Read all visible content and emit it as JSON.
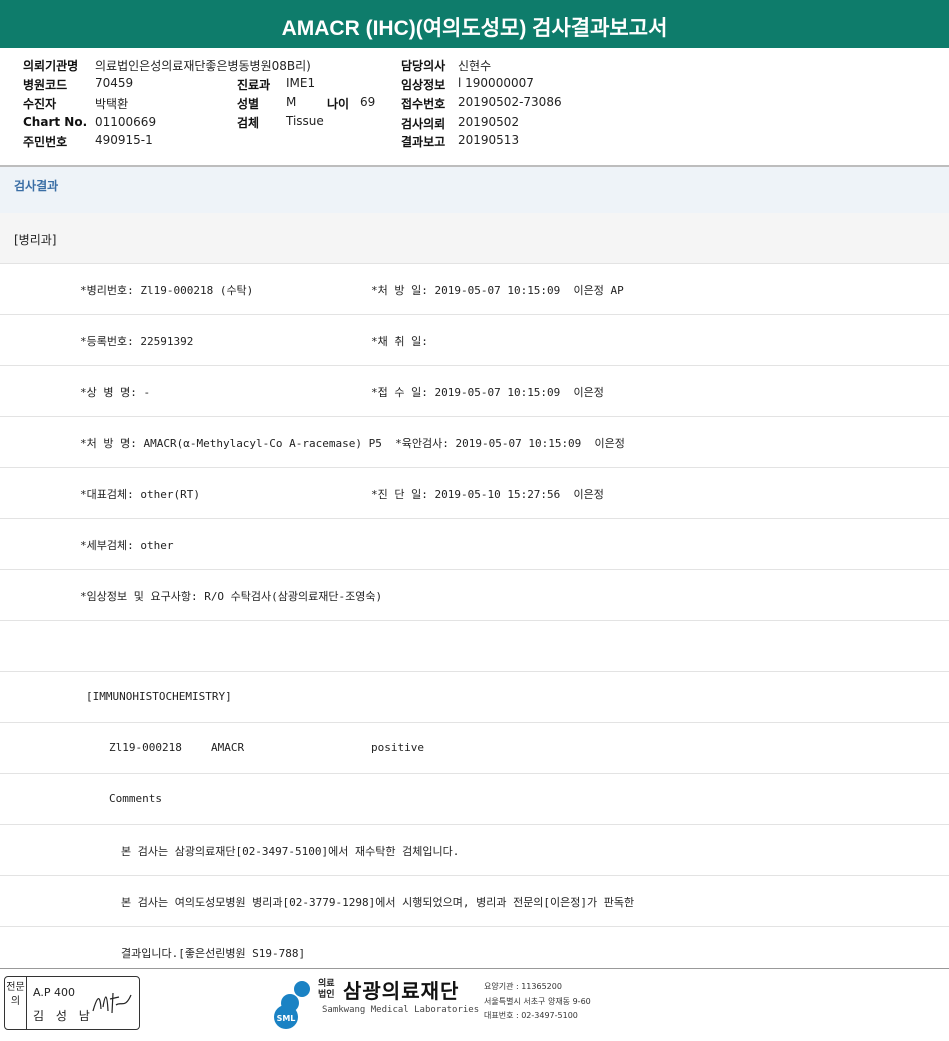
{
  "title": "AMACR (IHC)(여의도성모) 검사결과보고서",
  "header": {
    "rows": [
      {
        "label": "의뢰기관명",
        "value": "의료법인은성의료재단좋은병동병원08B리)"
      },
      {
        "label": "병원코드",
        "value": "70459"
      },
      {
        "label": "수진자",
        "value": "박택환"
      },
      {
        "label": "Chart No.",
        "value": "01100669"
      },
      {
        "label": "주민번호",
        "value": "490915-1"
      },
      {
        "label": "진료과",
        "value": "IME1"
      },
      {
        "label": "성별",
        "value": "M"
      },
      {
        "label": "나이",
        "value": "69"
      },
      {
        "label": "검체",
        "value": "Tissue"
      },
      {
        "label": "담당의사",
        "value": "신현수"
      },
      {
        "label": "임상정보",
        "value": "l 190000007"
      },
      {
        "label": "접수번호",
        "value": "20190502-73086"
      },
      {
        "label": "검사의뢰",
        "value": "20190502"
      },
      {
        "label": "결과보고",
        "value": "20190513"
      }
    ]
  },
  "section_title": "검사결과",
  "report_rows": [
    "[병리과]",
    "*병리번호: Zl19-000218 (수탁)",
    "*처 방 일: 2019-05-07 10:15:09  이은정 AP",
    "*등록번호: 22591392",
    "*채 취 일:",
    "*상 병 명: -",
    "*접 수 일: 2019-05-07 10:15:09  이은정",
    "*처 방 명: AMACR(α-Methylacyl-Co A-racemase) P5  *육안검사: 2019-05-07 10:15:09  이은정",
    "*대표검체: other(RT)",
    "*진 단 일: 2019-05-10 15:27:56  이은정",
    "*세부검체: other",
    "*임상정보 및 요구사항: R/O 수탁검사(삼광의료재단-조영숙)",
    "[IMMUNOHISTOCHEMISTRY]",
    "Zl19-000218",
    "AMACR",
    "positive",
    "Comments",
    "본 검사는 삼광의료재단[02-3497-5100]에서 재수탁한 검체입니다.",
    "본 검사는 여의도성모병원 병리과[02-3779-1298]에서 시행되었으며, 병리과 전문의[이은정]가 판독한",
    "결과입니다.[좋은선린병원 S19-788]"
  ],
  "footer": {
    "stamp_label": "전문의",
    "stamp_ap": "A.P 400",
    "stamp_name": "김 성 남",
    "stamp_signature": "김성남",
    "org_prefix": "의료 법인",
    "org_name": "삼광의료재단",
    "org_en": "Samkwang Medical Laboratories",
    "logo_text": "SML",
    "code": "요양기관 : 11365200",
    "address": "서울특별시 서초구 양재동 9-60",
    "phone": "대표번호 : 02-3497-5100"
  },
  "colors": {
    "title_bg": "#0e7c6b",
    "section_bg": "#eef3f8",
    "section_text": "#3a6ea5",
    "logo_blue": "#1a82c4"
  }
}
